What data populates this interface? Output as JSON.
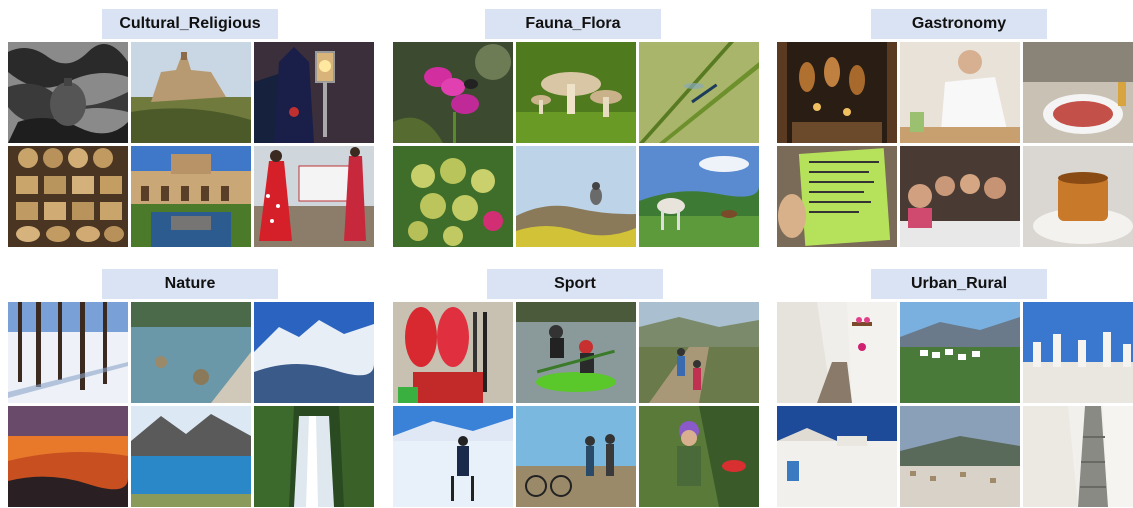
{
  "categories": [
    {
      "id": "cultural",
      "label": "Cultural_Religious",
      "photos": [
        "Textured wall with hanging ceramic jug",
        "Hilltop castle over river valley",
        "Hooded procession with ornate lantern",
        "Woven wicker baskets display",
        "Alhambra courtyard with reflecting pool",
        "Flamenco dancers in polka-dot dresses"
      ]
    },
    {
      "id": "fauna",
      "label": "Fauna_Flora",
      "photos": [
        "Pink flowers with bumblebee",
        "Mushrooms on mossy ground",
        "Damselfly on grass blade",
        "Green succulent flower heads",
        "Small bird perched on rock",
        "Horses grazing in meadow"
      ]
    },
    {
      "id": "gastro",
      "label": "Gastronomy",
      "photos": [
        "Market stall with hanging hams",
        "Chef preparing dishes",
        "Plate of cured ham on terrace",
        "Hand holding green menu card",
        "Group selfie at dinner table",
        "Caramel pastry dessert"
      ]
    },
    {
      "id": "nature",
      "label": "Nature",
      "photos": [
        "Snowy forest with tree shadows",
        "Clear mountain lake with rocks",
        "Snow-capped mountain range",
        "Orange sunset sky over hills",
        "Alpine lake below peaks",
        "Waterfall among green cliffs"
      ]
    },
    {
      "id": "sport",
      "label": "Sport",
      "photos": [
        "Red kayaks and gear",
        "Kayakers in river rapids",
        "Hikers on mountain path",
        "Skier on snowy slope",
        "Cyclists resting with bikes",
        "Child with climbing gear and helmet"
      ]
    },
    {
      "id": "urban",
      "label": "Urban_Rural",
      "photos": [
        "Whitewashed street with flower pots",
        "White village on green hillside",
        "Village rooftops with chimneys",
        "White houses under blue sky",
        "Hillside town at dusk",
        "Narrow white stepped alley"
      ]
    }
  ]
}
